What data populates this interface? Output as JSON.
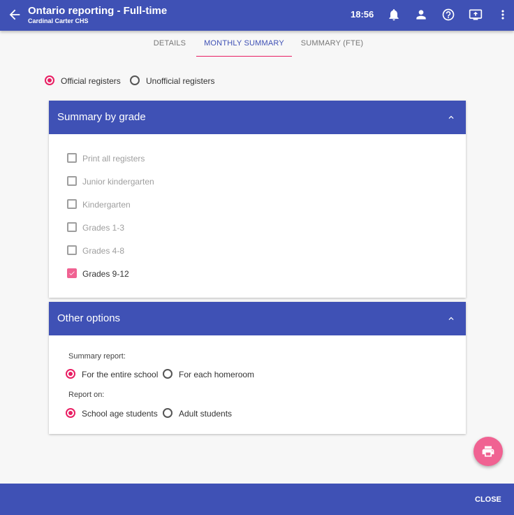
{
  "appbar": {
    "title": "Ontario reporting - Full-time",
    "subtitle": "Cardinal Carter CHS",
    "time": "18:56",
    "icons": [
      "back-arrow-icon",
      "bell-icon",
      "person-icon",
      "help-icon",
      "present-to-screen-icon",
      "more-vert-icon"
    ]
  },
  "tabs": [
    {
      "label": "DETAILS",
      "active": false
    },
    {
      "label": "MONTHLY SUMMARY",
      "active": true
    },
    {
      "label": "SUMMARY (FTE)",
      "active": false
    }
  ],
  "registers": {
    "options": [
      {
        "label": "Official registers",
        "selected": true
      },
      {
        "label": "Unofficial registers",
        "selected": false
      }
    ]
  },
  "summary_by_grade": {
    "title": "Summary by grade",
    "items": [
      {
        "label": "Print all registers",
        "checked": false
      },
      {
        "label": "Junior kindergarten",
        "checked": false
      },
      {
        "label": "Kindergarten",
        "checked": false
      },
      {
        "label": "Grades 1-3",
        "checked": false
      },
      {
        "label": "Grades 4-8",
        "checked": false
      },
      {
        "label": "Grades 9-12",
        "checked": true
      }
    ]
  },
  "other_options": {
    "title": "Other options",
    "summary_report": {
      "label": "Summary report:",
      "options": [
        {
          "label": "For the entire school",
          "selected": true
        },
        {
          "label": "For each homeroom",
          "selected": false
        }
      ]
    },
    "report_on": {
      "label": "Report on:",
      "options": [
        {
          "label": "School age students",
          "selected": true
        },
        {
          "label": "Adult students",
          "selected": false
        }
      ]
    }
  },
  "fab_icon": "print-icon",
  "footer": {
    "close_label": "CLOSE"
  },
  "colors": {
    "primary": "#3f51b5",
    "accent": "#e91e63",
    "fab": "#f06292"
  }
}
